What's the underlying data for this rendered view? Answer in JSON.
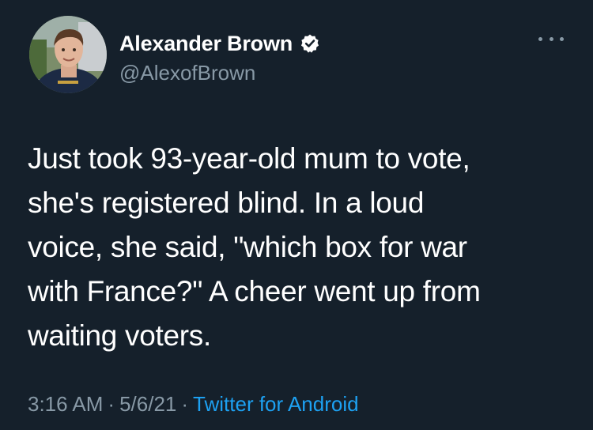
{
  "author": {
    "display_name": "Alexander Brown",
    "handle": "@AlexofBrown",
    "verified": true,
    "avatar_icon": "profile-photo"
  },
  "more_icon": "more-horizontal-icon",
  "tweet": {
    "lines": [
      "Just took 93-year-old mum to vote,",
      "she's registered blind. In a loud",
      "voice, she said, \"which box for war",
      "with France?\" A cheer went up from",
      "waiting voters."
    ],
    "time": "3:16 AM",
    "separator": "·",
    "date": "5/6/21",
    "source": "Twitter for Android"
  },
  "colors": {
    "background": "#15202b",
    "text": "#ffffff",
    "secondary": "#8899a6",
    "accent": "#1da1f2"
  }
}
